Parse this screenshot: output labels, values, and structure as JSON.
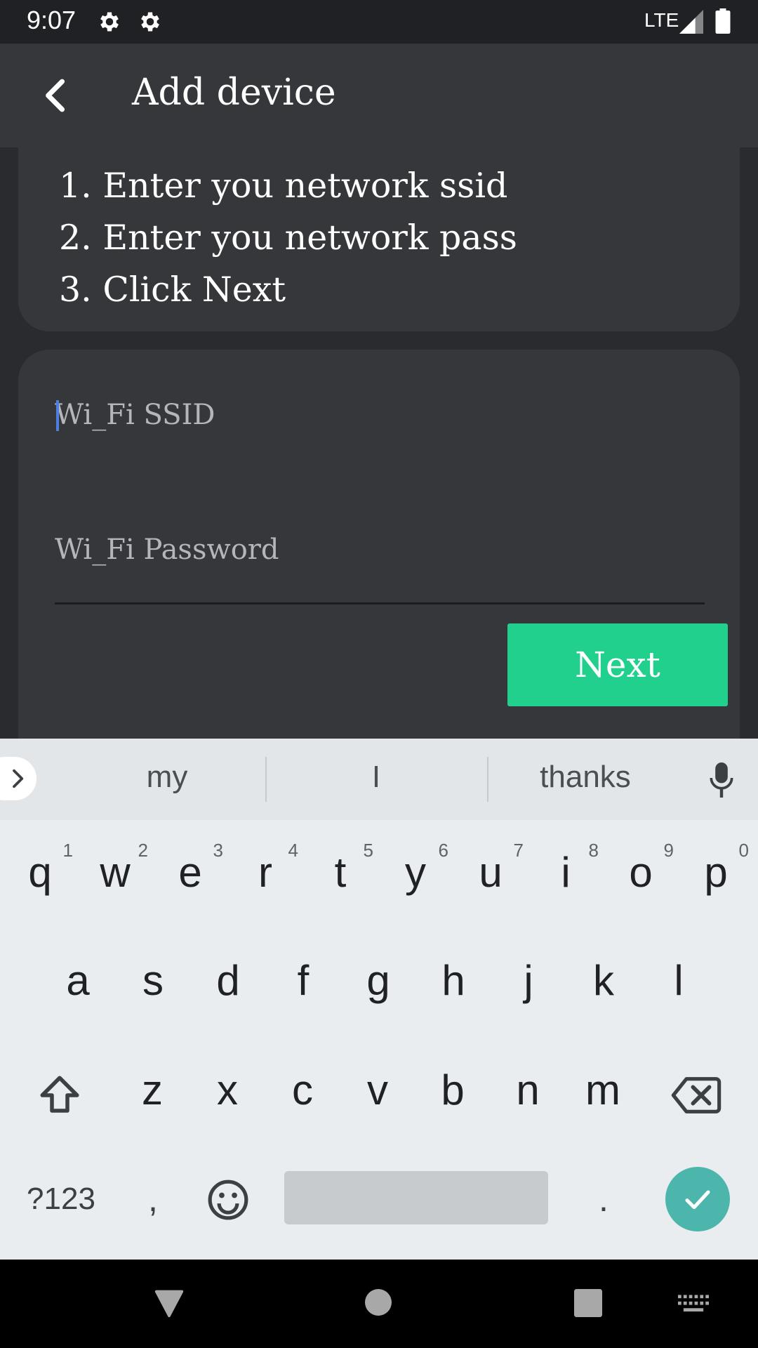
{
  "status_bar": {
    "time": "9:07",
    "network": "LTE"
  },
  "app_bar": {
    "title": "Add device"
  },
  "instructions": [
    "1. Enter you network ssid",
    "2. Enter you network pass",
    "3. Click Next"
  ],
  "form": {
    "ssid_placeholder": "Wi_Fi SSID",
    "password_placeholder": "Wi_Fi Password",
    "next_label": "Next"
  },
  "keyboard": {
    "suggestions": [
      "my",
      "I",
      "thanks"
    ],
    "row1": [
      {
        "key": "q",
        "hint": "1"
      },
      {
        "key": "w",
        "hint": "2"
      },
      {
        "key": "e",
        "hint": "3"
      },
      {
        "key": "r",
        "hint": "4"
      },
      {
        "key": "t",
        "hint": "5"
      },
      {
        "key": "y",
        "hint": "6"
      },
      {
        "key": "u",
        "hint": "7"
      },
      {
        "key": "i",
        "hint": "8"
      },
      {
        "key": "o",
        "hint": "9"
      },
      {
        "key": "p",
        "hint": "0"
      }
    ],
    "row2": [
      "a",
      "s",
      "d",
      "f",
      "g",
      "h",
      "j",
      "k",
      "l"
    ],
    "row3": [
      "z",
      "x",
      "c",
      "v",
      "b",
      "n",
      "m"
    ],
    "symbols_label": "?123",
    "comma": ",",
    "period": "."
  },
  "colors": {
    "accent_green": "#20d08c",
    "enter_key_teal": "#4db6ac",
    "cursor_blue": "#4d7fe0"
  }
}
